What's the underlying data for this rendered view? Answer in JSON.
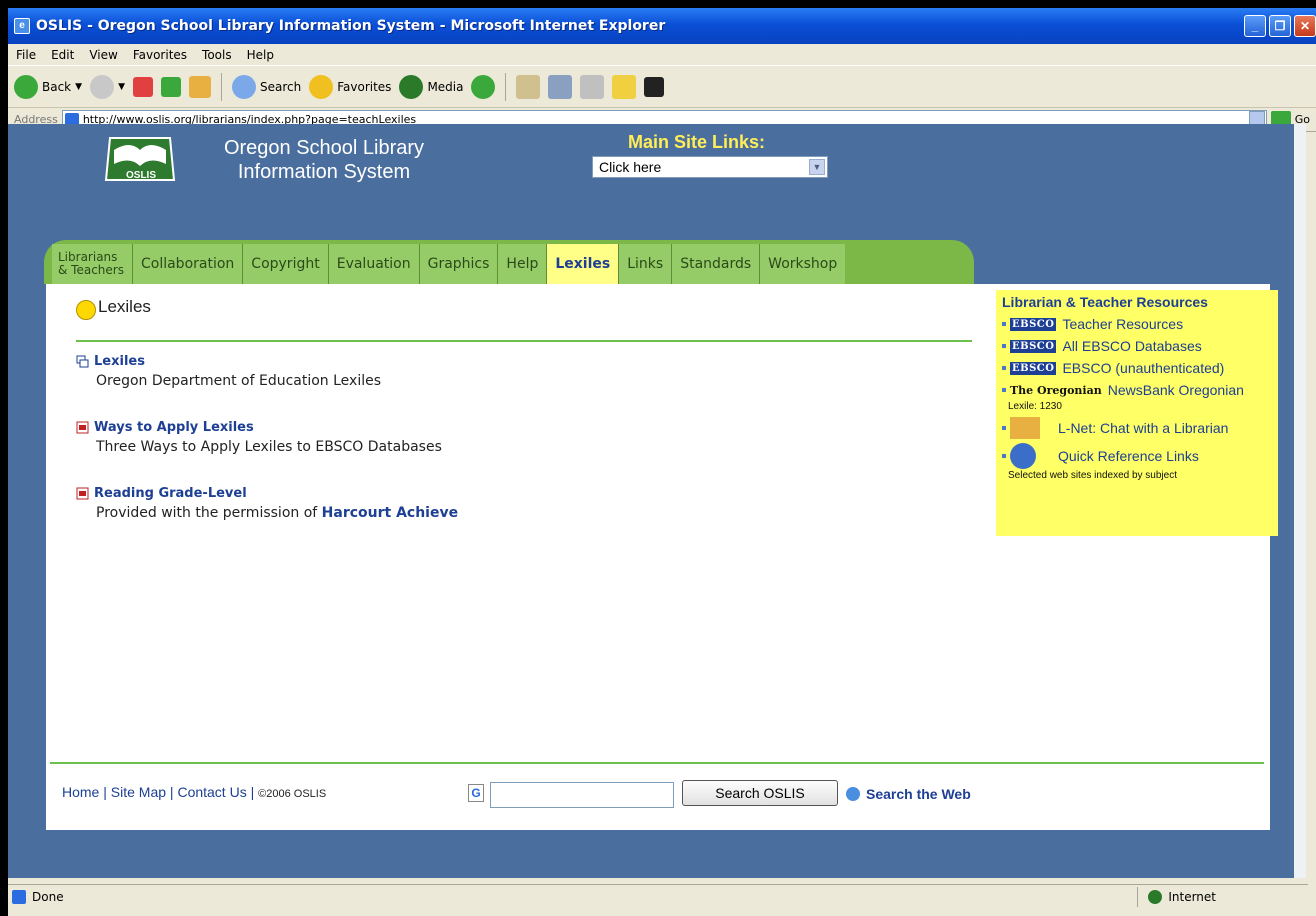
{
  "window": {
    "title": "OSLIS - Oregon School Library Information System - Microsoft Internet Explorer"
  },
  "menu": [
    "File",
    "Edit",
    "View",
    "Favorites",
    "Tools",
    "Help"
  ],
  "toolbar": {
    "back": "Back",
    "search": "Search",
    "favorites": "Favorites",
    "media": "Media"
  },
  "address": {
    "label": "Address",
    "url": "http://www.oslis.org/librarians/index.php?page=teachLexiles",
    "go": "Go"
  },
  "header": {
    "logo_text": "OSLIS",
    "site_name_line1": "Oregon School Library",
    "site_name_line2": "Information System",
    "main_links_label": "Main Site Links:",
    "main_links_select": "Click here"
  },
  "tabs": [
    {
      "label": "Librarians",
      "label2": "& Teachers"
    },
    {
      "label": "Collaboration"
    },
    {
      "label": "Copyright"
    },
    {
      "label": "Evaluation"
    },
    {
      "label": "Graphics"
    },
    {
      "label": "Help"
    },
    {
      "label": "Lexiles"
    },
    {
      "label": "Links"
    },
    {
      "label": "Standards"
    },
    {
      "label": "Workshop"
    }
  ],
  "page": {
    "title": "Lexiles",
    "items": [
      {
        "title": "Lexiles",
        "desc": "Oregon Department of Education Lexiles"
      },
      {
        "title": "Ways to Apply Lexiles",
        "desc": "Three Ways to Apply Lexiles to EBSCO Databases"
      },
      {
        "title": "Reading Grade-Level",
        "desc": "Provided with the permission of",
        "link": "Harcourt Achieve"
      }
    ]
  },
  "sidebar": {
    "heading": "Librarian & Teacher Resources",
    "ebsco_badge": "EBSCO",
    "oregonian_badge": "The Oregonian",
    "links": [
      "Teacher Resources",
      "All EBSCO Databases",
      "EBSCO (unauthenticated)",
      "NewsBank Oregonian",
      "L-Net: Chat with a Librarian",
      "Quick Reference Links"
    ],
    "lexile_note": "Lexile: 1230",
    "quickref_note": "Selected web sites indexed by subject"
  },
  "footer": {
    "home": "Home",
    "sitemap": "Site Map",
    "contact": "Contact Us",
    "copyright": "©2006 OSLIS",
    "google": "G",
    "search_button": "Search OSLIS",
    "search_web": "Search the Web"
  },
  "status": {
    "text": "Done",
    "zone": "Internet"
  }
}
